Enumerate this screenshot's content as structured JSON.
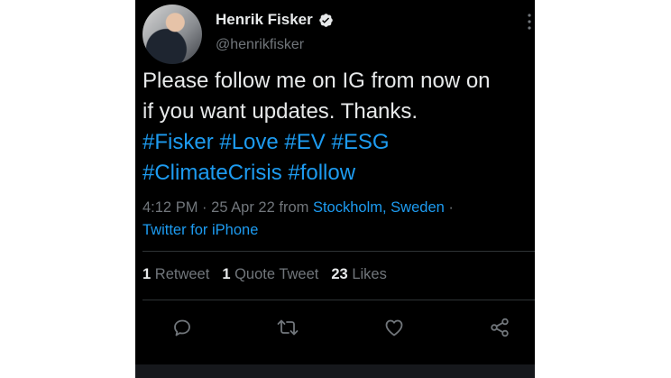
{
  "author": {
    "display_name": "Henrik Fisker",
    "handle": "@henrikfisker"
  },
  "tweet": {
    "line1": "Please follow me on IG from now on",
    "line2": "if you want updates. Thanks.",
    "hashtags_line1": [
      "#Fisker",
      "#Love",
      "#EV",
      "#ESG"
    ],
    "hashtags_line2": [
      "#ClimateCrisis",
      "#follow"
    ]
  },
  "meta": {
    "time": "4:12 PM",
    "date": "25 Apr 22",
    "from_text": "from",
    "location": "Stockholm, Sweden",
    "client": "Twitter for iPhone",
    "separator": "·"
  },
  "stats": {
    "retweets_count": "1",
    "retweets_label": "Retweet",
    "quotes_count": "1",
    "quotes_label": "Quote Tweet",
    "likes_count": "23",
    "likes_label": "Likes"
  },
  "colors": {
    "background": "#000000",
    "text": "#e7e9ea",
    "secondary": "#71767b",
    "link": "#1d9bf0"
  },
  "icons": [
    "verified-badge-icon",
    "more-icon",
    "reply-icon",
    "retweet-icon",
    "like-icon",
    "share-icon"
  ]
}
